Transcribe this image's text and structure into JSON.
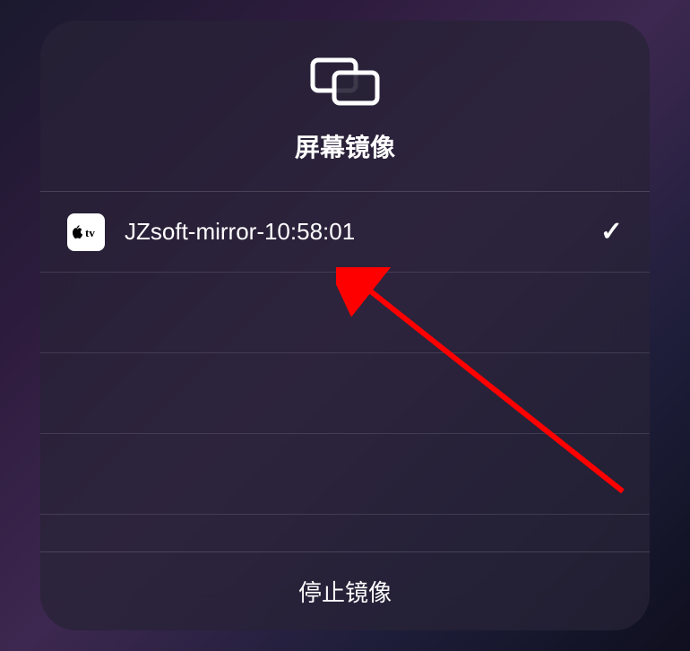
{
  "header": {
    "title": "屏幕镜像"
  },
  "devices": [
    {
      "name": "JZsoft-mirror-10:58:01",
      "type": "appletv",
      "selected": true
    }
  ],
  "actions": {
    "stop_label": "停止镜像"
  },
  "appletv_badge_text": "tv"
}
